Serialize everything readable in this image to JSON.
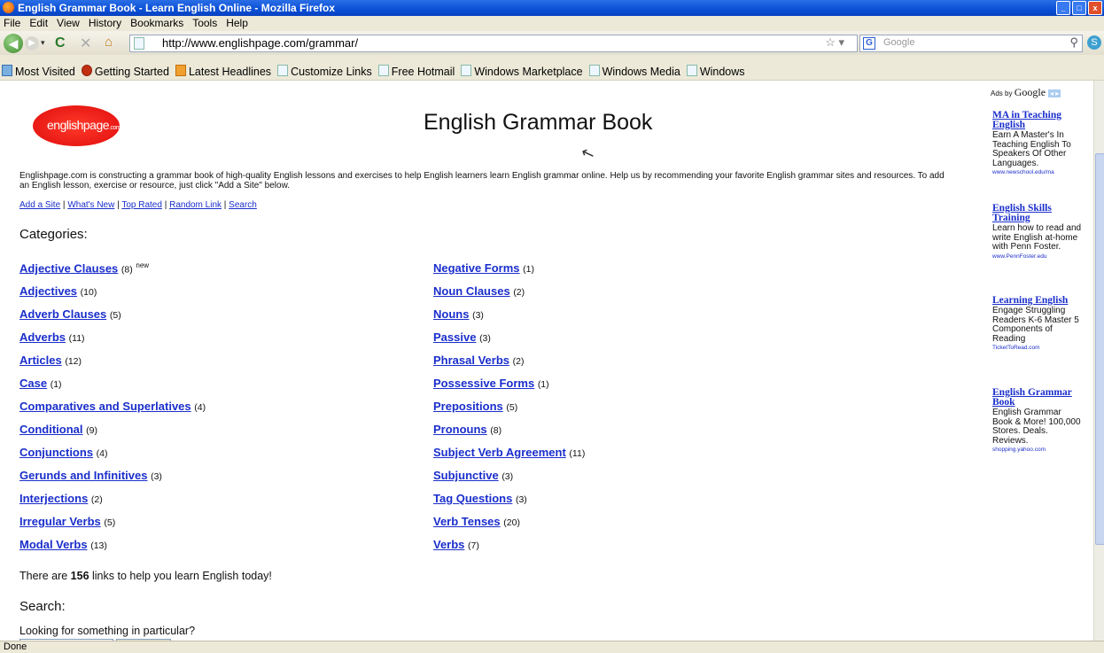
{
  "window": {
    "title": "English Grammar Book - Learn English Online - Mozilla Firefox"
  },
  "menu": [
    "File",
    "Edit",
    "View",
    "History",
    "Bookmarks",
    "Tools",
    "Help"
  ],
  "nav": {
    "url": "http://www.englishpage.com/grammar/",
    "search_placeholder": "Google"
  },
  "bookmarks": [
    "Most Visited",
    "Getting Started",
    "Latest Headlines",
    "Customize Links",
    "Free Hotmail",
    "Windows Marketplace",
    "Windows Media",
    "Windows"
  ],
  "page": {
    "logo_text": "englishpage",
    "logo_suffix": ".com",
    "title": "English Grammar Book",
    "intro": "Englishpage.com is constructing a grammar book of high-quality English lessons and exercises to help English learners learn English grammar online. Help us by recommending your favorite English grammar sites and resources. To add an English lesson, exercise or resource, just click \"Add a Site\" below.",
    "top_links": [
      "Add a Site",
      "What's New",
      "Top Rated",
      "Random Link",
      "Search"
    ],
    "categories_heading": "Categories:",
    "left_categories": [
      {
        "name": "Adjective Clauses",
        "count": "(8)",
        "note": "new"
      },
      {
        "name": "Adjectives",
        "count": "(10)",
        "note": ""
      },
      {
        "name": "Adverb Clauses",
        "count": "(5)",
        "note": ""
      },
      {
        "name": "Adverbs",
        "count": "(11)",
        "note": ""
      },
      {
        "name": "Articles",
        "count": "(12)",
        "note": ""
      },
      {
        "name": "Case",
        "count": "(1)",
        "note": ""
      },
      {
        "name": "Comparatives and Superlatives",
        "count": "(4)",
        "note": ""
      },
      {
        "name": "Conditional",
        "count": "(9)",
        "note": ""
      },
      {
        "name": "Conjunctions",
        "count": "(4)",
        "note": ""
      },
      {
        "name": "Gerunds and Infinitives",
        "count": "(3)",
        "note": ""
      },
      {
        "name": "Interjections",
        "count": "(2)",
        "note": ""
      },
      {
        "name": "Irregular Verbs",
        "count": "(5)",
        "note": ""
      },
      {
        "name": "Modal Verbs",
        "count": "(13)",
        "note": ""
      }
    ],
    "right_categories": [
      {
        "name": "Negative Forms",
        "count": "(1)"
      },
      {
        "name": "Noun Clauses",
        "count": "(2)"
      },
      {
        "name": "Nouns",
        "count": "(3)"
      },
      {
        "name": "Passive",
        "count": "(3)"
      },
      {
        "name": "Phrasal Verbs",
        "count": "(2)"
      },
      {
        "name": "Possessive Forms",
        "count": "(1)"
      },
      {
        "name": "Prepositions",
        "count": "(5)"
      },
      {
        "name": "Pronouns",
        "count": "(8)"
      },
      {
        "name": "Subject Verb Agreement",
        "count": "(11)"
      },
      {
        "name": "Subjunctive",
        "count": "(3)"
      },
      {
        "name": "Tag Questions",
        "count": "(3)"
      },
      {
        "name": "Verb Tenses",
        "count": "(20)"
      },
      {
        "name": "Verbs",
        "count": "(7)"
      }
    ],
    "link_count_pre": "There are ",
    "link_count": "156",
    "link_count_post": " links to help you learn English today!",
    "search_heading": "Search:",
    "search_prompt": "Looking for something in particular?"
  },
  "ads": {
    "label": "Ads by",
    "brand": "Google",
    "items": [
      {
        "title": "MA in Teaching English",
        "body": "Earn A Master's In Teaching English To Speakers Of Other Languages.",
        "url": "www.newschool.edu/ma"
      },
      {
        "title": "English Skills Training",
        "body": "Learn how to read and write English at-home with Penn Foster.",
        "url": "www.PennFoster.edu"
      },
      {
        "title": "Learning English",
        "body": "Engage Struggling Readers K-6 Master 5 Components of Reading",
        "url": "TicketToRead.com"
      },
      {
        "title": "English Grammar Book",
        "body": "English Grammar Book & More! 100,000 Stores. Deals. Reviews.",
        "url": "shopping.yahoo.com"
      }
    ]
  },
  "status": "Done"
}
